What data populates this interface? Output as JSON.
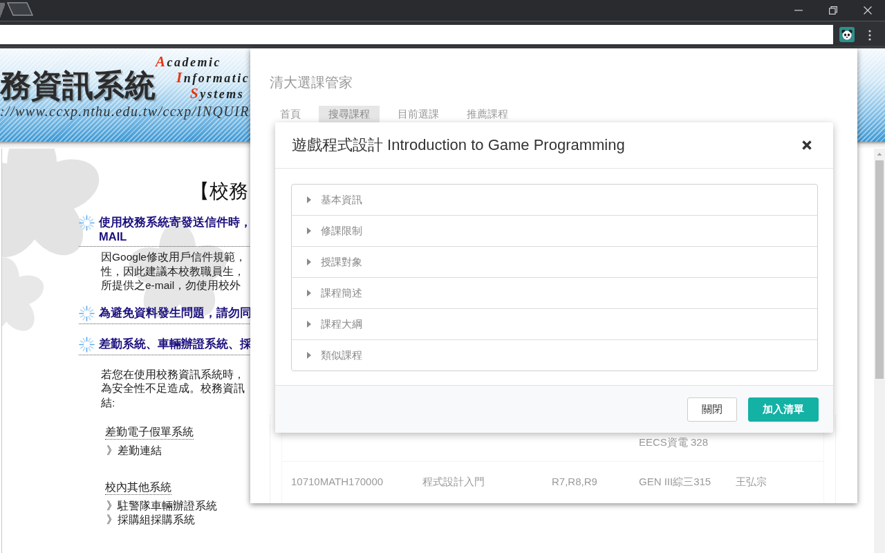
{
  "banner": {
    "title": "務資訊系統",
    "acronym_lines": [
      {
        "initial": "A",
        "rest": "cademic"
      },
      {
        "initial": "I",
        "rest": "nformatic"
      },
      {
        "initial": "S",
        "rest": "ystems"
      }
    ],
    "url": "://www.ccxp.nthu.edu.tw/ccxp/INQUIR"
  },
  "page": {
    "heading": "【校務",
    "sections": [
      {
        "title_lines": [
          "使用校務系統寄發送信件時，",
          "MAIL"
        ],
        "paragraph": [
          "因Google修改用戶信件規範，",
          "性，因此建議本校教職員生，",
          "所提供之e-mail，勿使用校外"
        ]
      },
      {
        "title_lines": [
          "為避免資料發生問題，請勿同"
        ]
      },
      {
        "title_lines": [
          "差勤系統、車輛辦證系統、採"
        ],
        "paragraph": [
          "若您在使用校務資訊系統時，",
          "為安全性不足造成。校務資訊",
          "結:"
        ],
        "link_groups": [
          {
            "label": "差勤電子假單系統",
            "links": [
              "》差勤連結"
            ]
          },
          {
            "label": "校內其他系統",
            "links": [
              "》駐警隊車輛辦證系統",
              "》採購組採購系統"
            ]
          }
        ]
      }
    ]
  },
  "popup": {
    "app_title": "清大選課管家",
    "tabs": [
      {
        "label": "首頁",
        "selected": false
      },
      {
        "label": "搜尋課程",
        "selected": true
      },
      {
        "label": "目前選課",
        "selected": false
      },
      {
        "label": "推薦課程",
        "selected": false
      }
    ],
    "table_rows": [
      {
        "column_4": "EECS資電 328"
      },
      {
        "column_1": "10710MATH170000",
        "column_2": "程式設計入門",
        "column_3": "R7,R8,R9",
        "column_4": "GEN III綜三315",
        "column_5": "王弘宗"
      }
    ]
  },
  "modal": {
    "title": "遊戲程式設計 Introduction to Game Programming",
    "sections": [
      {
        "label": "基本資訊",
        "expanded": false
      },
      {
        "label": "修課限制",
        "expanded": false
      },
      {
        "label": "授課對象",
        "expanded": false
      },
      {
        "label": "課程簡述",
        "expanded": false
      },
      {
        "label": "課程大綱",
        "expanded": false
      },
      {
        "label": "類似課程",
        "expanded": false
      }
    ],
    "buttons": [
      {
        "label": "關閉",
        "kind": "secondary"
      },
      {
        "label": "加入清單",
        "kind": "primary"
      }
    ]
  }
}
